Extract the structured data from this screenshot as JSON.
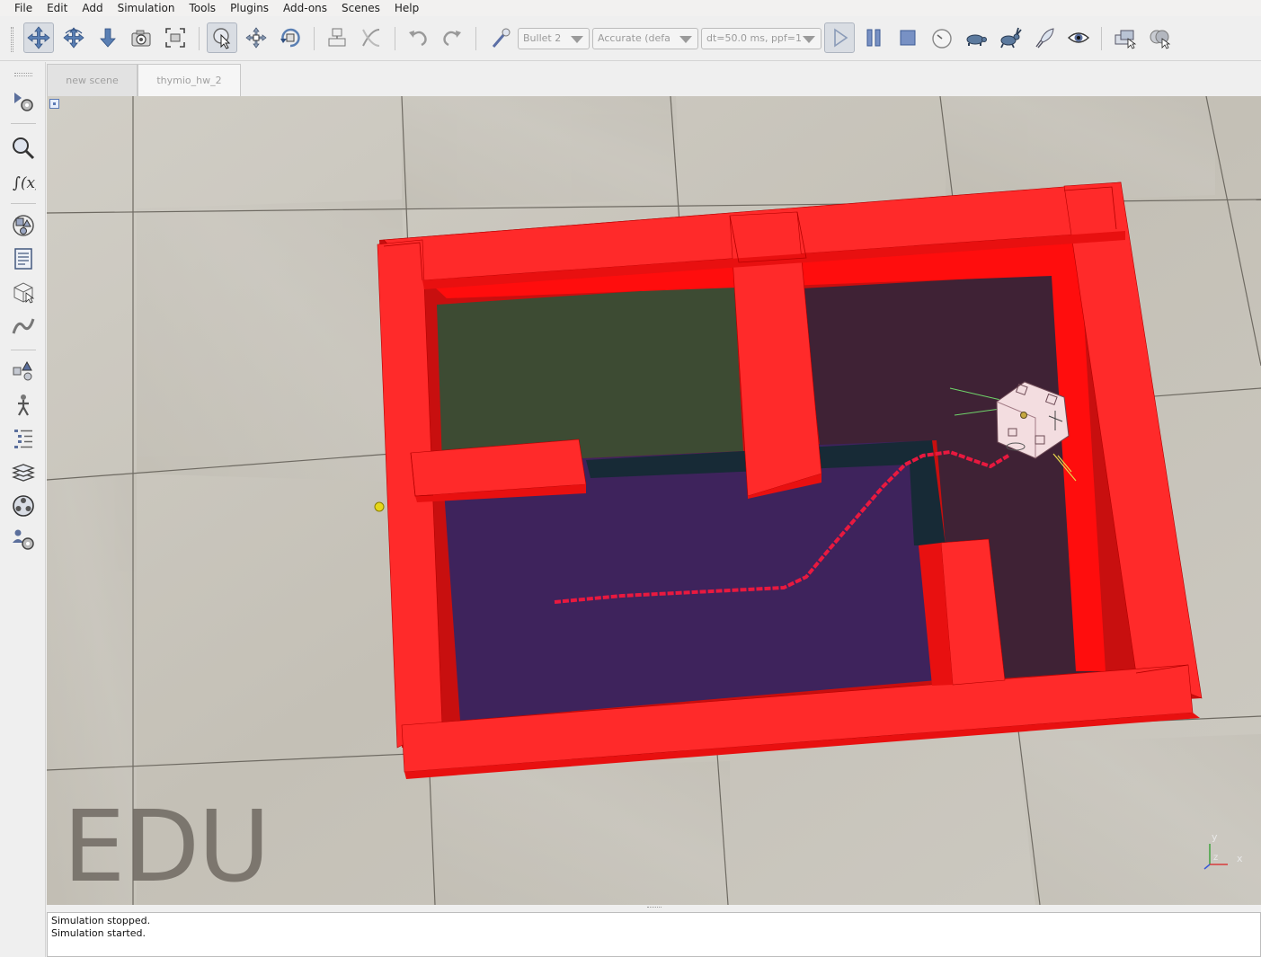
{
  "menu": [
    "File",
    "Edit",
    "Add",
    "Simulation",
    "Tools",
    "Plugins",
    "Add-ons",
    "Scenes",
    "Help"
  ],
  "toolbar": {
    "physics_engine": "Bullet 2",
    "accuracy": "Accurate (defa",
    "timestep": "dt=50.0 ms, ppf=1",
    "icons": {
      "camera_pan": "move-arrows-icon",
      "camera_rotate": "rotate-arrows-icon",
      "camera_shift": "shift-down-icon",
      "camera_angle": "camera-icon",
      "fit_to_view": "fit-view-icon",
      "click_select": "select-cursor-icon",
      "object_shift": "object-shift-icon",
      "object_rotate": "object-rotate-icon",
      "assemble": "assemble-icon",
      "transfer_dna": "transfer-dna-icon",
      "undo": "undo-icon",
      "redo": "redo-icon",
      "dynamics": "dynamics-wand-icon",
      "start": "play-icon",
      "pause": "pause-icon",
      "stop": "stop-icon",
      "realtime": "clock-icon",
      "slow_down": "turtle-icon",
      "speed_up": "rabbit-icon",
      "threaded_rendering": "rocket-icon",
      "visualization": "eye-icon",
      "page_selector": "pages-icon",
      "scene_selector": "scenes-icon"
    }
  },
  "left_toolbar_icons": [
    "simulation-settings-icon",
    "model-browser-icon",
    "calc-module-icon",
    "collections-icon",
    "scripts-icon",
    "shape-edit-icon",
    "path-edit-icon",
    "selection-icon",
    "scene-hierarchy-icon",
    "layers-icon",
    "video-recorder-icon",
    "user-settings-icon"
  ],
  "tabs": [
    {
      "label": "new scene",
      "active": false
    },
    {
      "label": "thymio_hw_2",
      "active": true
    }
  ],
  "viewport": {
    "watermark": "EDU",
    "axis": {
      "x": "x",
      "y": "y",
      "z": "z"
    },
    "colors": {
      "walls": "#ff2a2a",
      "wall_shadow": "#e01010",
      "floor_green": "#3d4b33",
      "floor_purple": "#3e235c",
      "floor_dark": "#3f2235",
      "path": "#e8193f",
      "robot": "#f3dde0"
    }
  },
  "console": {
    "lines": [
      "Simulation stopped.",
      "Simulation started."
    ]
  }
}
